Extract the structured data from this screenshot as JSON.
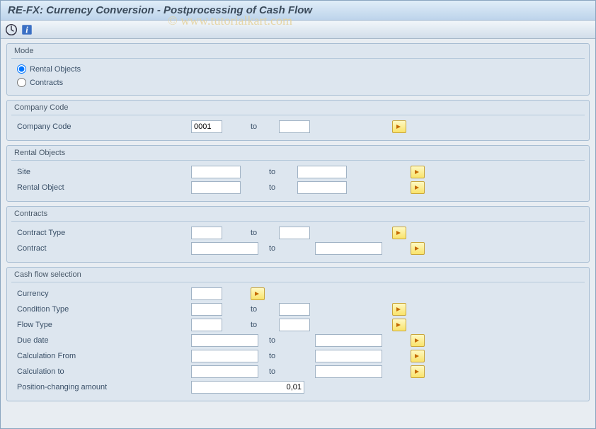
{
  "title": "RE-FX: Currency Conversion - Postprocessing of Cash Flow",
  "watermark": "© www.tutorialkart.com",
  "groups": {
    "mode": {
      "title": "Mode",
      "rentalObjects": "Rental Objects",
      "contracts": "Contracts"
    },
    "companyCode": {
      "title": "Company Code",
      "label": "Company Code",
      "from": "0001",
      "to_text": "to",
      "to_value": ""
    },
    "rentalObjects": {
      "title": "Rental Objects",
      "rows": [
        {
          "label": "Site",
          "from": "",
          "to": ""
        },
        {
          "label": "Rental Object",
          "from": "",
          "to": ""
        }
      ],
      "to_text": "to"
    },
    "contracts": {
      "title": "Contracts",
      "rows": [
        {
          "label": "Contract Type",
          "from": "",
          "to": ""
        },
        {
          "label": "Contract",
          "from": "",
          "to": ""
        }
      ],
      "to_text": "to"
    },
    "cashflow": {
      "title": "Cash flow selection",
      "currencyLabel": "Currency",
      "currencyValue": "",
      "rows": [
        {
          "label": "Condition Type",
          "from": "",
          "to": ""
        },
        {
          "label": "Flow Type",
          "from": "",
          "to": ""
        },
        {
          "label": "Due date",
          "from": "",
          "to": ""
        },
        {
          "label": "Calculation From",
          "from": "",
          "to": ""
        },
        {
          "label": "Calculation to",
          "from": "",
          "to": ""
        }
      ],
      "to_text": "to",
      "posLabel": "Position-changing amount",
      "posValue": "0,01"
    }
  }
}
